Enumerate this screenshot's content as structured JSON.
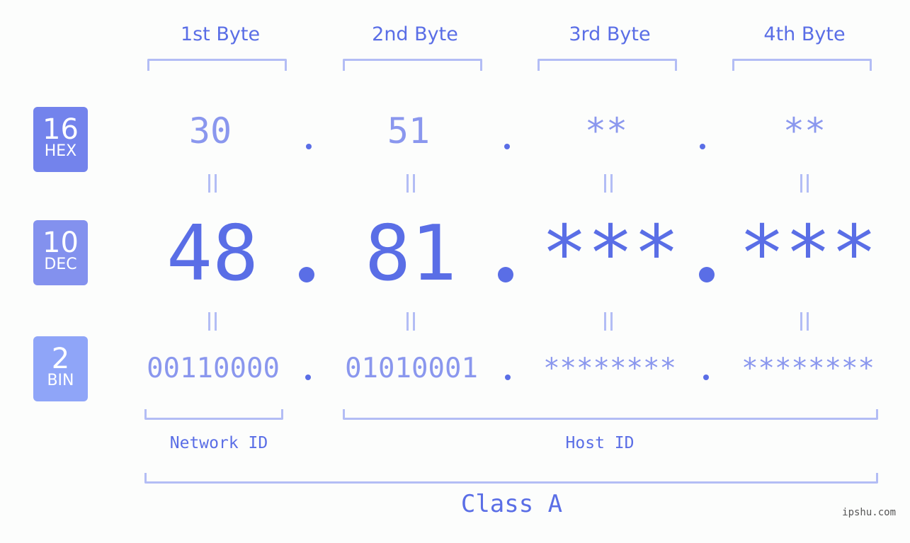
{
  "bytes": [
    {
      "header": "1st Byte",
      "hex": "30",
      "dec": "48",
      "bin": "00110000"
    },
    {
      "header": "2nd Byte",
      "hex": "51",
      "dec": "81",
      "bin": "01010001"
    },
    {
      "header": "3rd Byte",
      "hex": "**",
      "dec": "***",
      "bin": "********"
    },
    {
      "header": "4th Byte",
      "hex": "**",
      "dec": "***",
      "bin": "********"
    }
  ],
  "bases": {
    "hex": {
      "num": "16",
      "label": "HEX",
      "color": "#7383ec"
    },
    "dec": {
      "num": "10",
      "label": "DEC",
      "color": "#8391ee"
    },
    "bin": {
      "num": "2",
      "label": "BIN",
      "color": "#8fa5f8"
    }
  },
  "equals_symbol": "=",
  "segments": {
    "network_id": "Network ID",
    "host_id": "Host ID"
  },
  "ip_class": "Class A",
  "watermark": "ipshu.com",
  "colors": {
    "primary": "#5a6ee6",
    "secondary": "#8a97ee",
    "bracket": "#b3bdf5"
  }
}
